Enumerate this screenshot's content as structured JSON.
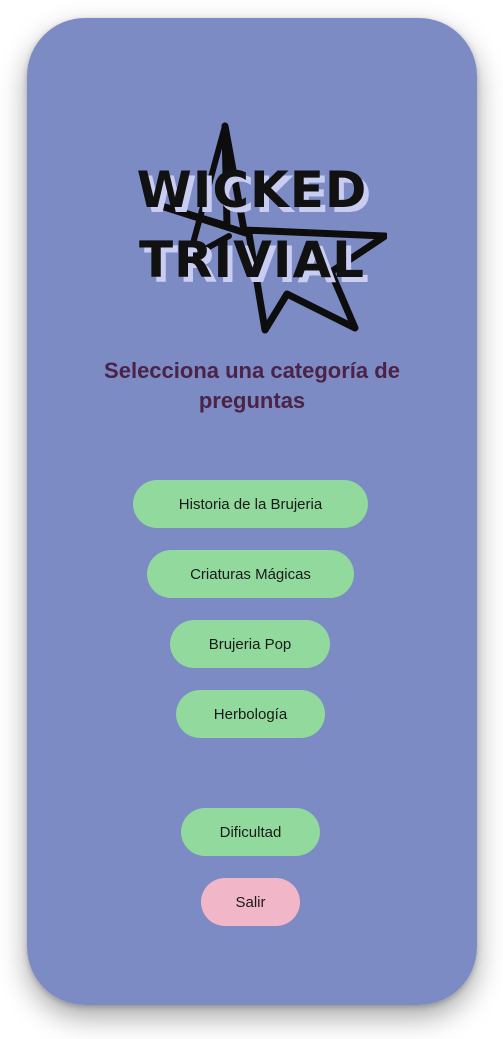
{
  "app": {
    "logo_line1": "WICKED",
    "logo_line2": "TRIVIAL",
    "logo_icon": "star-outline-icon",
    "subtitle": "Selecciona una categoría de preguntas"
  },
  "categories": [
    {
      "label": "Historia de la Brujeria"
    },
    {
      "label": "Criaturas Mágicas"
    },
    {
      "label": "Brujeria Pop"
    },
    {
      "label": "Herbología"
    }
  ],
  "actions": {
    "difficulty_label": "Dificultad",
    "exit_label": "Salir"
  },
  "colors": {
    "background": "#7d8bc5",
    "subtitle": "#4a2346",
    "category_button": "#91d99c",
    "exit_button": "#f1b7c8",
    "logo_shadow": "#c9cdf2"
  }
}
